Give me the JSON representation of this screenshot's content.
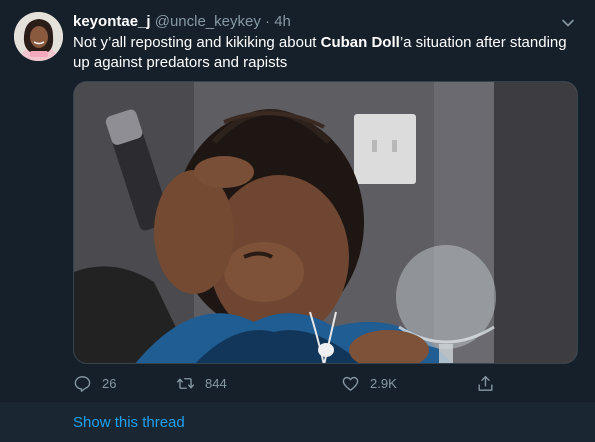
{
  "tweet": {
    "display_name": "keyontae_j",
    "handle": "@uncle_keykey",
    "separator": "·",
    "time": "4h",
    "text_before": "Not y’all reposting and kikiking about ",
    "text_bold": "Cuban Doll",
    "text_after": "’a situation after standing up against predators and rapists",
    "media_alt": "photo"
  },
  "actions": {
    "reply_count": "26",
    "retweet_count": "844",
    "like_count": "2.9K"
  },
  "footer": {
    "show_thread_label": "Show this thread"
  },
  "colors": {
    "background": "#15202b",
    "secondary_text": "#8899a6",
    "link": "#1da1f2"
  },
  "icons": [
    "chevron-down-icon",
    "reply-icon",
    "retweet-icon",
    "like-icon",
    "share-icon"
  ]
}
